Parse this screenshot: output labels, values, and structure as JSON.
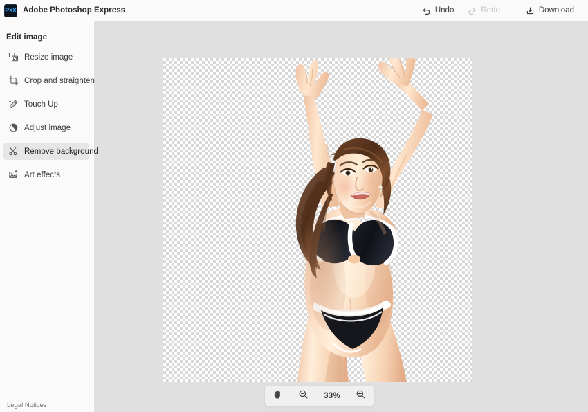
{
  "header": {
    "logo_text": "PsX",
    "logo_name": "photoshop-express-logo",
    "title": "Adobe Photoshop Express",
    "actions": [
      {
        "label": "Undo",
        "icon": "undo-arrow-icon",
        "disabled": false
      },
      {
        "label": "Redo",
        "icon": "redo-arrow-icon",
        "disabled": true
      },
      {
        "label": "Download",
        "icon": "download-tray-icon",
        "disabled": false
      }
    ]
  },
  "sidebar": {
    "title": "Edit image",
    "items": [
      {
        "label": "Resize image",
        "icon": "resize-image-icon",
        "active": false
      },
      {
        "label": "Crop and straighten",
        "icon": "crop-straighten-icon",
        "active": false
      },
      {
        "label": "Touch Up",
        "icon": "touch-up-brush-icon",
        "active": false
      },
      {
        "label": "Adjust image",
        "icon": "adjust-contrast-icon",
        "active": false
      },
      {
        "label": "Remove background",
        "icon": "scissors-icon",
        "active": true
      },
      {
        "label": "Art effects",
        "icon": "art-effects-icon",
        "active": false
      }
    ],
    "legal_notices": "Legal Notices"
  },
  "canvas": {
    "background": "transparent-checkerboard",
    "content_description": "Photo of a smiling woman in a black and white bikini with both arms raised, background removed"
  },
  "zoombar": {
    "hand_icon": "hand-pan-icon",
    "zoom_out_icon": "zoom-out-icon",
    "zoom_level": "33%",
    "zoom_in_icon": "zoom-in-icon"
  },
  "colors": {
    "header_bg": "#fafafa",
    "sidebar_bg": "#fafafa",
    "workarea_bg": "#e0e0e0",
    "active_item_bg": "#e6e6e6",
    "logo_blue": "#31a8ff",
    "logo_tile": "#0a1520"
  }
}
